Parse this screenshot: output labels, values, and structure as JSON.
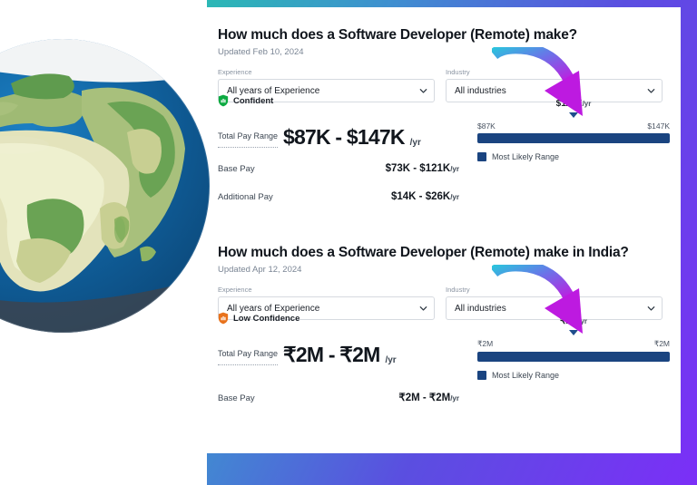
{
  "theme": {
    "accent_purple": "#7b2ff7",
    "accent_teal": "#2bb8b5",
    "bar_navy": "#1a4480",
    "confident_green": "#0caa41",
    "low_confidence_orange": "#e8721c",
    "card_bg": "#ffffff",
    "page_bg": "#ffffff"
  },
  "decoration": {
    "globe_icon": "earth-globe-africa-europe",
    "arrow_icon": "curved-down-right-arrow",
    "arrow_gradient_from": "#2bc4dd",
    "arrow_gradient_to": "#c21ae0"
  },
  "sections": [
    {
      "title": "How much does a Software Developer (Remote) make?",
      "updated": "Updated Feb 10, 2024",
      "filters": [
        {
          "label": "Experience",
          "value": "All years of Experience",
          "icon": "chevron-down-icon"
        },
        {
          "label": "Industry",
          "value": "All industries",
          "icon": "chevron-down-icon"
        }
      ],
      "confidence": {
        "label": "Confident",
        "icon": "shield-bars-icon",
        "color": "#0caa41"
      },
      "total_pay": {
        "label": "Total Pay Range",
        "value": "$87K - $147K",
        "unit": "/yr"
      },
      "pay_lines": [
        {
          "label": "Base Pay",
          "value": "$73K - $121K",
          "unit": "/yr"
        },
        {
          "label": "Additional Pay",
          "value": "$14K - $26K",
          "unit": "/yr"
        }
      ],
      "chart": {
        "marker_value": "$113K",
        "marker_unit": "/yr",
        "min_label": "$87K",
        "max_label": "$147K",
        "legend_label": "Most Likely Range"
      }
    },
    {
      "title": "How much does a Software Developer (Remote) make in India?",
      "updated": "Updated Apr 12, 2024",
      "filters": [
        {
          "label": "Experience",
          "value": "All years of Experience",
          "icon": "chevron-down-icon"
        },
        {
          "label": "Industry",
          "value": "All industries",
          "icon": "chevron-down-icon"
        }
      ],
      "confidence": {
        "label": "Low Confidence",
        "icon": "shield-bars-icon",
        "color": "#e8721c"
      },
      "total_pay": {
        "label": "Total Pay Range",
        "value": "₹2M - ₹2M",
        "unit": "/yr"
      },
      "pay_lines": [
        {
          "label": "Base Pay",
          "value": "₹2M - ₹2M",
          "unit": "/yr"
        }
      ],
      "chart": {
        "marker_value": "₹2M",
        "marker_unit": "/yr",
        "min_label": "₹2M",
        "max_label": "₹2M",
        "legend_label": "Most Likely Range"
      }
    }
  ],
  "chart_data": [
    {
      "type": "bar",
      "title": "Software Developer (Remote) total pay range",
      "categories": [
        "Total Pay Range"
      ],
      "values": [
        113
      ],
      "range_low": 87,
      "range_high": 147,
      "marker": 113,
      "units": "USD thousands per year",
      "xlabel": "",
      "ylabel": "",
      "ylim": [
        87,
        147
      ],
      "legend": [
        "Most Likely Range"
      ],
      "legend_position": "below",
      "grid": false,
      "tick_labels": [
        "$87K",
        "$147K"
      ],
      "annotations": [
        "$113K/yr"
      ]
    },
    {
      "type": "bar",
      "title": "Software Developer (Remote) total pay range in India",
      "categories": [
        "Total Pay Range"
      ],
      "values": [
        2
      ],
      "range_low": 2,
      "range_high": 2,
      "marker": 2,
      "units": "INR millions per year",
      "xlabel": "",
      "ylabel": "",
      "ylim": [
        2,
        2
      ],
      "legend": [
        "Most Likely Range"
      ],
      "legend_position": "below",
      "grid": false,
      "tick_labels": [
        "₹2M",
        "₹2M"
      ],
      "annotations": [
        "₹2M/yr"
      ]
    }
  ]
}
